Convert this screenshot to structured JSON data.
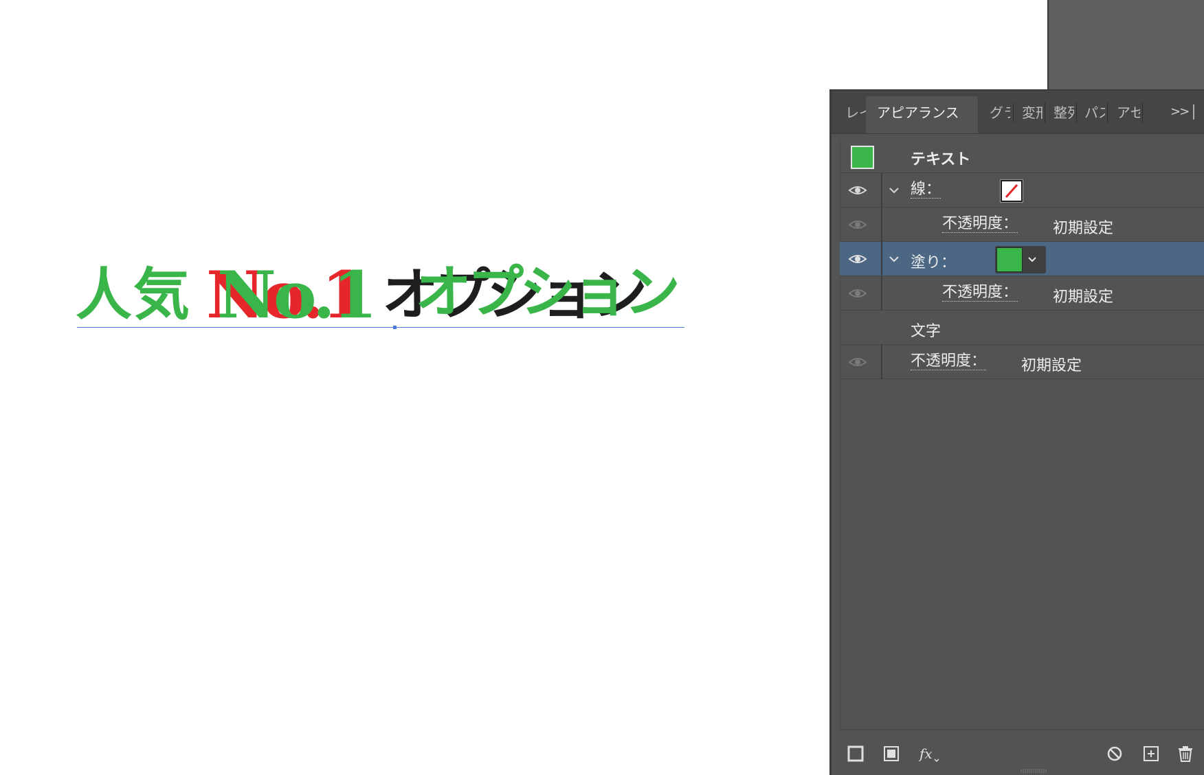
{
  "artwork": {
    "text_ninki": "人気",
    "text_no1": "No.1",
    "text_option": "オプション"
  },
  "panel": {
    "tabs": [
      {
        "label": "レイ",
        "active": false
      },
      {
        "label": "アピアランス",
        "active": true
      },
      {
        "label": "グラ",
        "active": false
      },
      {
        "label": "変形",
        "active": false
      },
      {
        "label": "整列",
        "active": false
      },
      {
        "label": "パス",
        "active": false
      },
      {
        "label": "アセ",
        "active": false
      }
    ],
    "more_label": ">>",
    "header_title": "テキスト",
    "stroke_label": "線：",
    "stroke_opacity_label": "不透明度：",
    "stroke_opacity_value": "初期設定",
    "fill_label": "塗り：",
    "fill_opacity_label": "不透明度：",
    "fill_opacity_value": "初期設定",
    "characters_label": "文字",
    "opacity_label": "不透明度：",
    "opacity_value": "初期設定"
  },
  "colors": {
    "fill_green": "#39b54a",
    "accent_red": "#e5262b",
    "selected_row": "#4c6784",
    "panel_bg": "#535353"
  },
  "icons": {
    "bottom": [
      "add-new-stroke-icon",
      "add-new-fill-icon",
      "add-new-effect-icon",
      "clear-appearance-icon",
      "duplicate-item-icon",
      "delete-item-icon"
    ]
  }
}
